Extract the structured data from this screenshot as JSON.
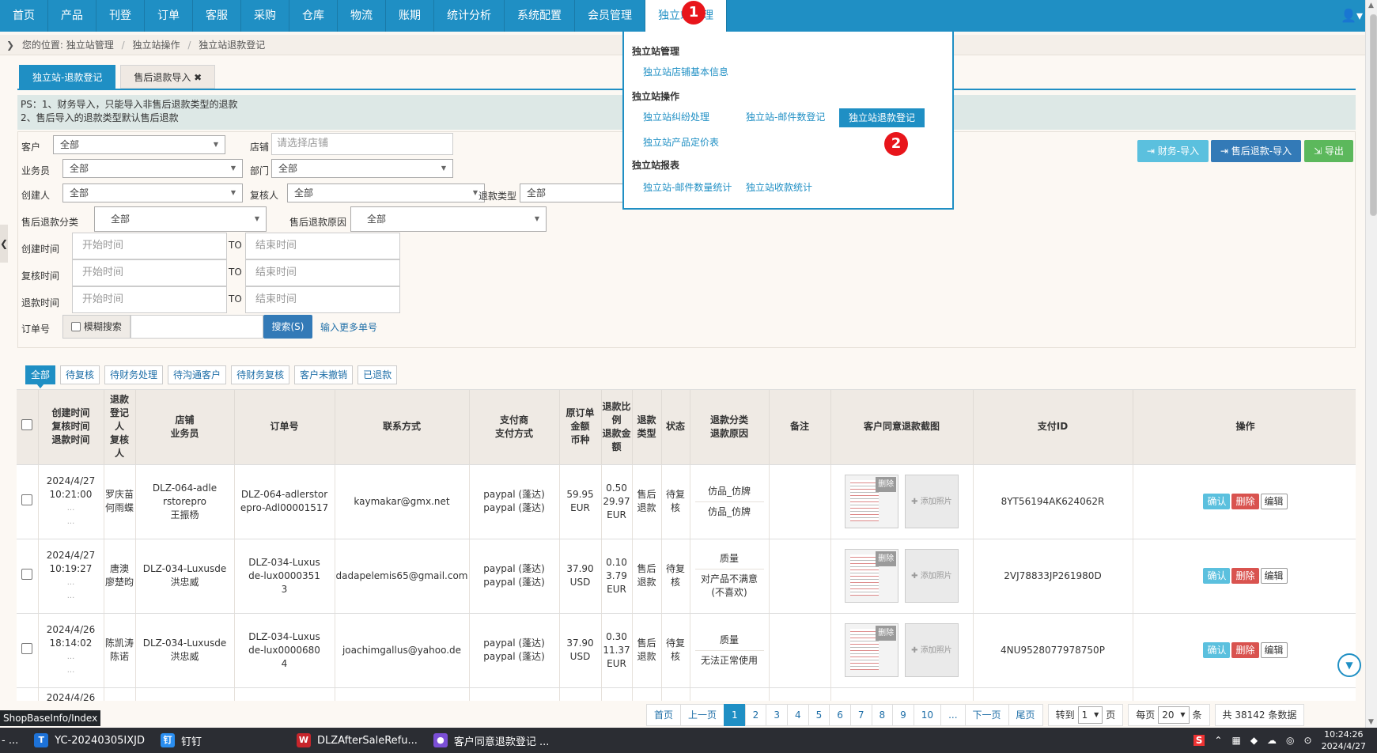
{
  "topnav": {
    "items": [
      "首页",
      "产品",
      "刊登",
      "订单",
      "客服",
      "采购",
      "仓库",
      "物流",
      "账期",
      "统计分析",
      "系统配置",
      "会员管理",
      "独立站管理"
    ],
    "user_icon": "user-icon"
  },
  "breadcrumb": {
    "prefix": "您的位置:",
    "items": [
      "独立站管理",
      "独立站操作",
      "独立站退款登记"
    ]
  },
  "tabs": [
    "独立站-退款登记",
    "售后退款导入 ✖"
  ],
  "ps": [
    "PS：1、财务导入，只能导入非售后退款类型的退款",
    "2、售后导入的退款类型默认售后退款"
  ],
  "filters": {
    "customer_label": "客户",
    "customer_value": "全部",
    "shop_label": "店铺",
    "shop_placeholder": "请选择店铺",
    "salesman_label": "业务员",
    "salesman_value": "全部",
    "dept_label": "部门",
    "dept_value": "全部",
    "creator_label": "创建人",
    "creator_value": "全部",
    "reviewer_label": "复核人",
    "reviewer_value": "全部",
    "refund_type_label": "退款类型",
    "refund_type_value": "全部",
    "aftersale_cat_label": "售后退款分类",
    "aftersale_cat_value": "全部",
    "aftersale_reason_label": "售后退款原因",
    "aftersale_reason_value": "全部",
    "create_time_label": "创建时间",
    "review_time_label": "复核时间",
    "refund_time_label": "退款时间",
    "start_placeholder": "开始时间",
    "end_placeholder": "结束时间",
    "to": "TO",
    "order_label": "订单号",
    "fuzzy_label": "模糊搜索",
    "search_btn": "搜索(S)",
    "more_link": "输入更多单号"
  },
  "actions": {
    "finance_import": "财务-导入",
    "aftersale_import": "售后退款-导入",
    "export": "导出"
  },
  "status_tabs": [
    "全部",
    "待复核",
    "待财务处理",
    "待沟通客户",
    "待财务复核",
    "客户未撤销",
    "已退款"
  ],
  "table": {
    "headers": [
      [
        "创建时间",
        "复核时间",
        "退款时间"
      ],
      [
        "退款",
        "登记",
        "人",
        "复核",
        "人"
      ],
      [
        "店铺",
        "业务员"
      ],
      [
        "订单号"
      ],
      [
        "联系方式"
      ],
      [
        "支付商",
        "支付方式"
      ],
      [
        "原订单",
        "金额",
        "币种"
      ],
      [
        "退款比",
        "例",
        "退款金",
        "额"
      ],
      [
        "退款",
        "类型"
      ],
      [
        "状态"
      ],
      [
        "退款分类",
        "退款原因"
      ],
      [
        "备注"
      ],
      [
        "客户同意退款截图"
      ],
      [
        "支付ID"
      ],
      [
        "操作"
      ]
    ],
    "rows": [
      {
        "date": "2024/4/27",
        "time": "10:21:00",
        "registrar": "罗庆苗",
        "reviewer": "何雨蝶",
        "shop": "DLZ-064-adlerstorepro",
        "salesman": "王振杨",
        "order": "DLZ-064-adlerstorepro-Adl00001517",
        "contact": "kaymakar@gmx.net",
        "payer": "paypal (蓬达)",
        "paymethod": "paypal (蓬达)",
        "amount": "59.95",
        "currency": "EUR",
        "ratio": "0.50",
        "refund_amount": "29.97",
        "refund_currency": "EUR",
        "type": "售后退款",
        "status": "待复核",
        "cat": "仿品_仿牌",
        "reason": "仿品_仿牌",
        "payid": "8YT56194AK624062R"
      },
      {
        "date": "2024/4/27",
        "time": "10:19:27",
        "registrar": "唐澳",
        "reviewer": "廖楚昀",
        "shop": "DLZ-034-Luxusde",
        "salesman": "洪忠威",
        "order": "DLZ-034-Luxusde-lux00003513",
        "contact": "dadapelemis65@gmail.com",
        "payer": "paypal (蓬达)",
        "paymethod": "paypal (蓬达)",
        "amount": "37.90",
        "currency": "USD",
        "ratio": "0.10",
        "refund_amount": "3.79",
        "refund_currency": "EUR",
        "type": "售后退款",
        "status": "待复核",
        "cat": "质量",
        "reason": "对产品不满意(不喜欢)",
        "payid": "2VJ78833JP261980D"
      },
      {
        "date": "2024/4/26",
        "time": "18:14:02",
        "registrar": "陈凯涛",
        "reviewer": "陈诺",
        "shop": "DLZ-034-Luxusde",
        "salesman": "洪忠威",
        "order": "DLZ-034-Luxusde-lux00006804",
        "contact": "joachimgallus@yahoo.de",
        "payer": "paypal (蓬达)",
        "paymethod": "paypal (蓬达)",
        "amount": "37.90",
        "currency": "USD",
        "ratio": "0.30",
        "refund_amount": "11.37",
        "refund_currency": "EUR",
        "type": "售后退款",
        "status": "待复核",
        "cat": "质量",
        "reason": "无法正常使用",
        "payid": "4NU9528077978750P"
      },
      {
        "date": "2024/4/26"
      }
    ],
    "ellipsis": "...",
    "delete_label": "删除",
    "add_photo": "添加照片",
    "row_actions": {
      "confirm": "确认",
      "delete": "删除",
      "edit": "编辑"
    }
  },
  "pager": {
    "first": "首页",
    "prev": "上一页",
    "pages": [
      "1",
      "2",
      "3",
      "4",
      "5",
      "6",
      "7",
      "8",
      "9",
      "10",
      "..."
    ],
    "next": "下一页",
    "last": "尾页",
    "goto_label": "转到",
    "goto_value": "1",
    "page_unit": "页",
    "per_label": "每页",
    "per_value": "20",
    "per_unit": "条",
    "total": "共 38142 条数据"
  },
  "url_tip": "ShopBaseInfo/Index",
  "dropdown": {
    "section1": "独立站管理",
    "s1_links": [
      "独立站店铺基本信息"
    ],
    "section2": "独立站操作",
    "s2_links": [
      "独立站纠纷处理",
      "独立站-邮件数登记",
      "独立站退款登记",
      "独立站产品定价表"
    ],
    "section3": "独立站报表",
    "s3_links": [
      "独立站-邮件数量统计",
      "独立站收款统计"
    ]
  },
  "badges": [
    "1",
    "2"
  ],
  "taskbar": {
    "start": "- ...",
    "items": [
      "YC-20240305IXJD",
      "钉钉",
      "DLZAfterSaleRefu...",
      "客户同意退款登记 ..."
    ],
    "time": "10:24:26",
    "date": "2024/4/27"
  },
  "colors": {
    "primary": "#1f8fc4",
    "danger": "#d9534f",
    "info": "#5bc0de",
    "success": "#5cb85c",
    "badge": "#e8151b"
  }
}
